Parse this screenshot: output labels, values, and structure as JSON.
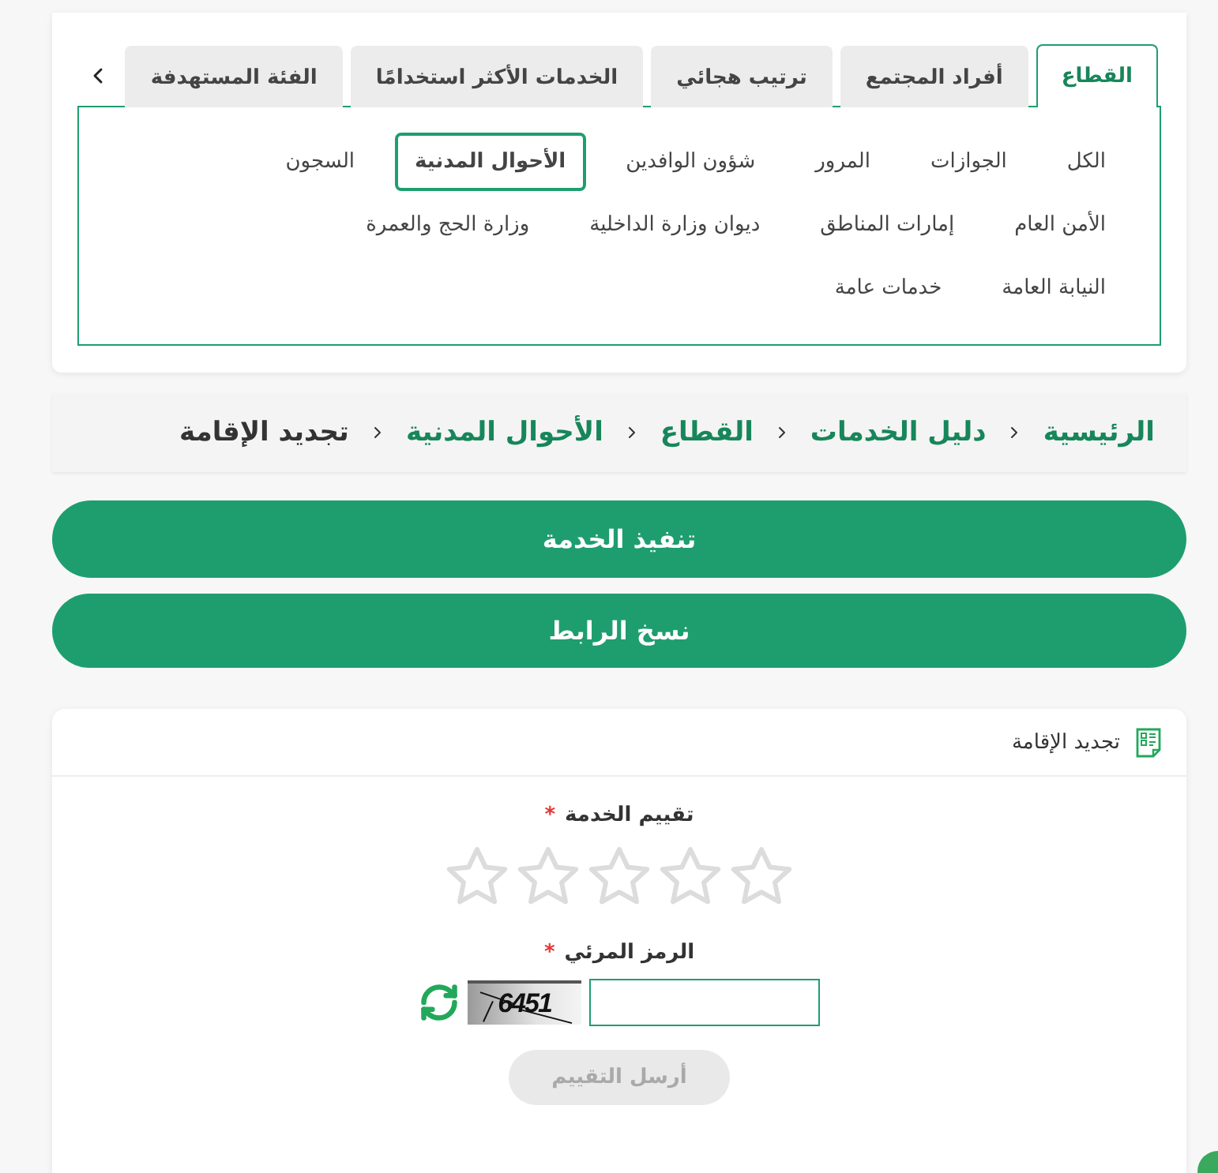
{
  "tabs": [
    {
      "label": "القطاع",
      "selected": true
    },
    {
      "label": "أفراد المجتمع",
      "selected": false
    },
    {
      "label": "ترتيب هجائي",
      "selected": false
    },
    {
      "label": "الخدمات الأكثر استخدامًا",
      "selected": false
    },
    {
      "label": "الفئة المستهدفة",
      "selected": false
    }
  ],
  "sectors": [
    {
      "label": "الكل",
      "selected": false
    },
    {
      "label": "الجوازات",
      "selected": false
    },
    {
      "label": "المرور",
      "selected": false
    },
    {
      "label": "شؤون الوافدين",
      "selected": false
    },
    {
      "label": "الأحوال المدنية",
      "selected": true
    },
    {
      "label": "السجون",
      "selected": false
    },
    {
      "label": "الأمن العام",
      "selected": false
    },
    {
      "label": "إمارات المناطق",
      "selected": false
    },
    {
      "label": "ديوان وزارة الداخلية",
      "selected": false
    },
    {
      "label": "وزارة الحج والعمرة",
      "selected": false
    },
    {
      "label": "النيابة العامة",
      "selected": false
    },
    {
      "label": "خدمات عامة",
      "selected": false
    }
  ],
  "breadcrumb": [
    {
      "label": "الرئيسية",
      "current": false
    },
    {
      "label": "دليل الخدمات",
      "current": false
    },
    {
      "label": "القطاع",
      "current": false
    },
    {
      "label": "الأحوال المدنية",
      "current": false
    },
    {
      "label": "تجديد الإقامة",
      "current": true
    }
  ],
  "actions": [
    "تنفيذ الخدمة",
    "نسخ الرابط"
  ],
  "form": {
    "title": "تجديد الإقامة",
    "rating": {
      "label": "تقييم الخدمة",
      "required_mark": "*",
      "stars": 0
    },
    "captcha": {
      "label": "الرمز المرئي",
      "required_mark": "*",
      "code": "6451"
    },
    "submit": {
      "label": "أرسل التقييم",
      "disabled": true
    }
  }
}
